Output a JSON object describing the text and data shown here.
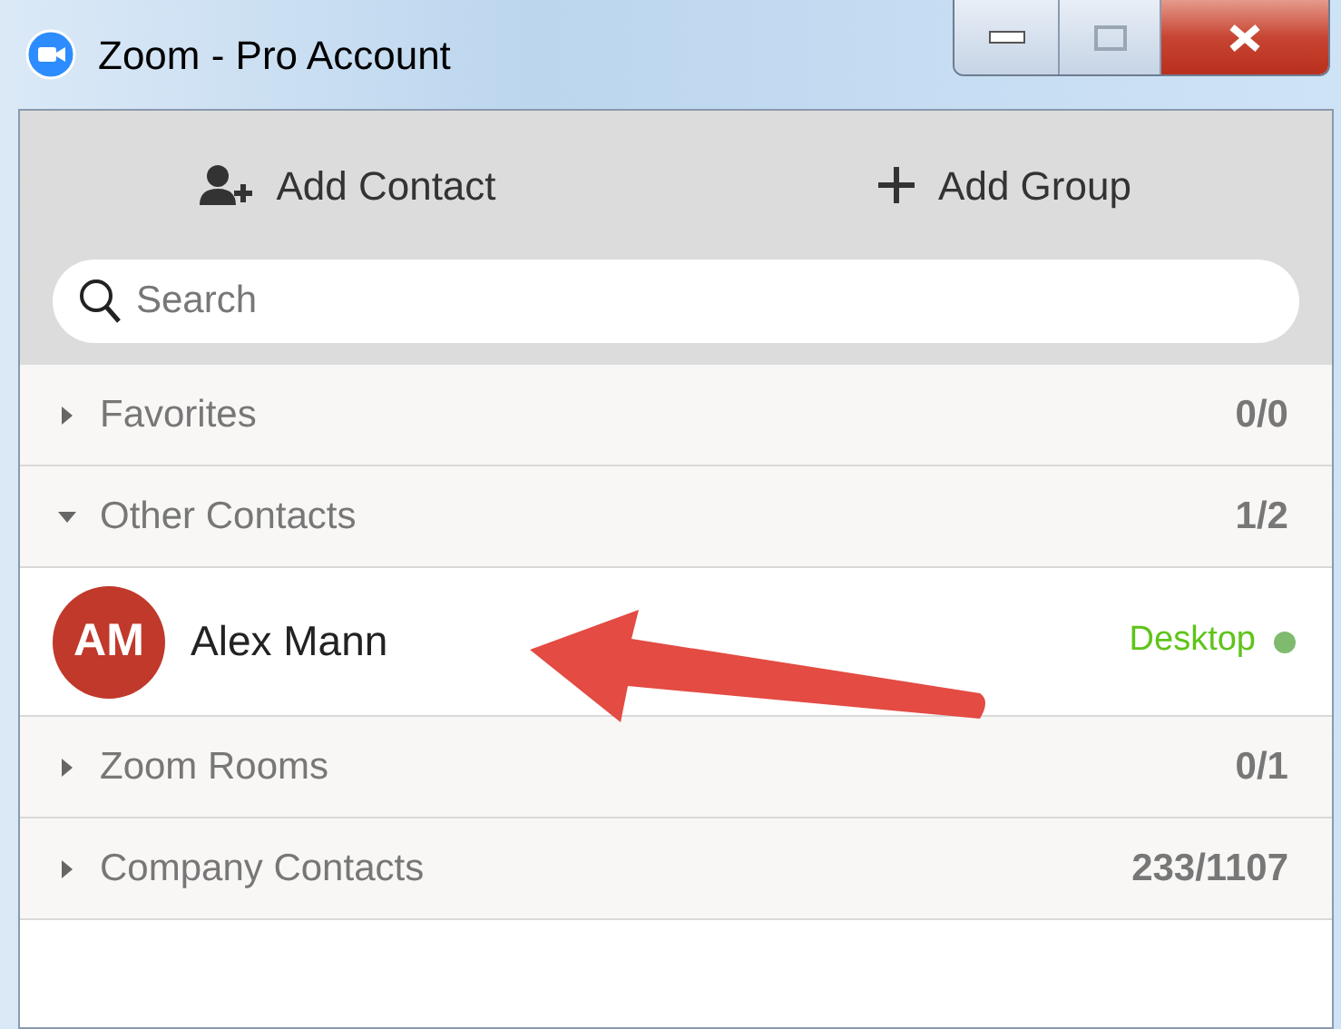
{
  "window": {
    "title": "Zoom - Pro Account"
  },
  "toolbar": [
    {
      "kind": "add-contact",
      "label": "Add Contact"
    },
    {
      "kind": "add-group",
      "label": "Add Group"
    }
  ],
  "search": {
    "placeholder": "Search"
  },
  "groups": [
    {
      "name": "Favorites",
      "count": "0/0",
      "expanded": false
    },
    {
      "name": "Other Contacts",
      "count": "1/2",
      "expanded": true,
      "children": [
        {
          "initials": "AM",
          "name": "Alex Mann",
          "status": "Desktop",
          "online": true
        }
      ]
    },
    {
      "name": "Zoom Rooms",
      "count": "0/1",
      "expanded": false
    },
    {
      "name": "Company Contacts",
      "count": "233/1107",
      "expanded": false
    }
  ]
}
